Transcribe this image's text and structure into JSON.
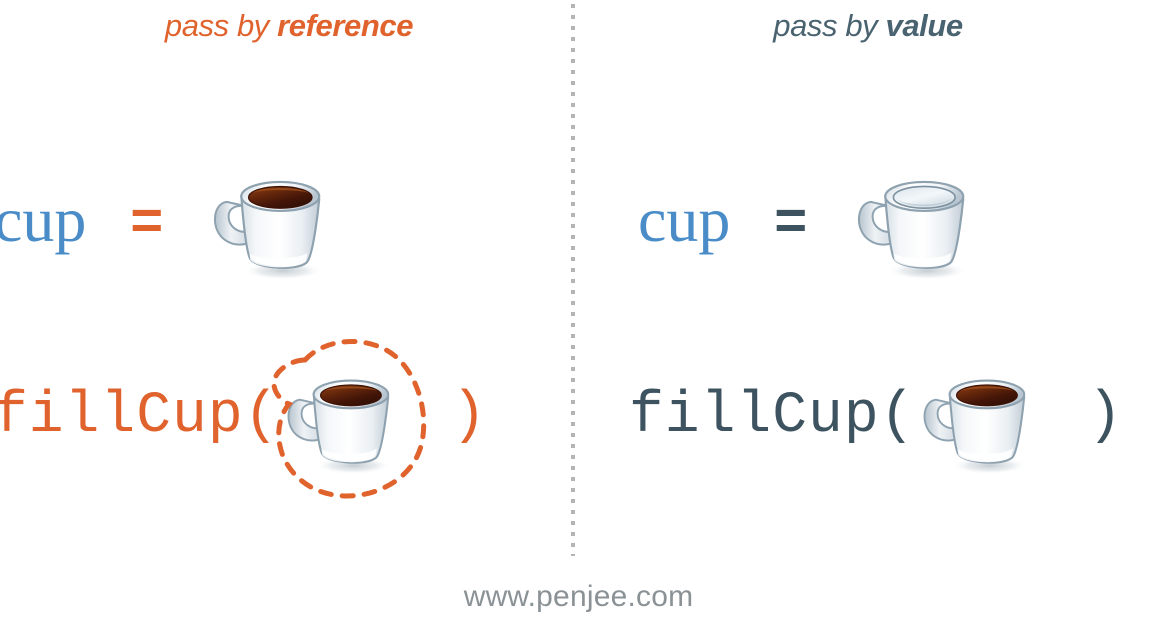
{
  "footer": {
    "site": "www.penjee.com"
  },
  "divider": {
    "style": "vertical-dotted",
    "color": "#b4b4b4"
  },
  "colors": {
    "orange": "#e0622c",
    "blue": "#4a8cc7",
    "slate": "#3d5360",
    "header_slate": "#4a6370",
    "footer_gray": "#8b9296",
    "coffee_dark": "#3c1206",
    "coffee_mid": "#5a2008",
    "coffee_light": "#8a4020",
    "cup_white": "#fbfcfd",
    "cup_shade": "#c6d1da",
    "background": "#ffffff"
  },
  "panels": [
    {
      "id": "pass-by-reference",
      "header": {
        "prefix": "pass by ",
        "emphasis": "reference"
      },
      "rows": [
        {
          "id": "assignment",
          "variable": "cup",
          "operator": "=",
          "cup": {
            "state": "full",
            "highlighted": false
          }
        },
        {
          "id": "function-call",
          "call_open": "fillCup(",
          "call_close": ")",
          "cup": {
            "state": "full",
            "highlighted": true
          }
        }
      ]
    },
    {
      "id": "pass-by-value",
      "header": {
        "prefix": "pass by ",
        "emphasis": "value"
      },
      "rows": [
        {
          "id": "assignment",
          "variable": "cup",
          "operator": "=",
          "cup": {
            "state": "empty",
            "highlighted": false
          }
        },
        {
          "id": "function-call",
          "call_open": "fillCup(",
          "call_close": ")",
          "cup": {
            "state": "full",
            "highlighted": false
          }
        }
      ]
    }
  ]
}
